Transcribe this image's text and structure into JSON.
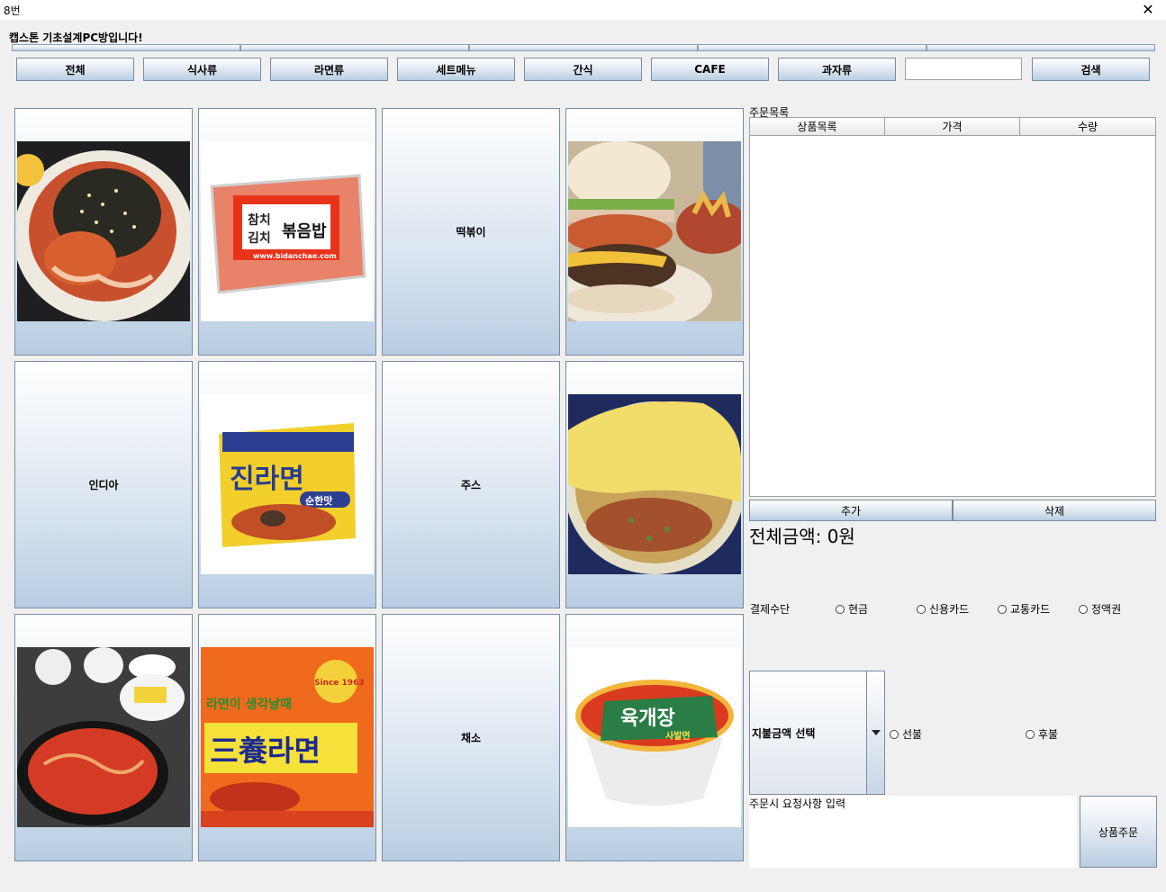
{
  "window": {
    "title": "8번",
    "close_glyph": "✕"
  },
  "header": {
    "text": "캡스톤 기초설계PC방입니다!"
  },
  "categories": [
    "전체",
    "식사류",
    "라면류",
    "세트메뉴",
    "간식",
    "CAFE",
    "과자류"
  ],
  "search": {
    "value": "",
    "button_label": "검색"
  },
  "menu_tiles": [
    {
      "label": "",
      "image": "bibimbap-photo"
    },
    {
      "label": "",
      "image": "fried-rice-package-photo",
      "image_text": [
        "참치",
        "김치",
        "볶음밥",
        "www.bidanchae.com"
      ]
    },
    {
      "label": "떡볶이",
      "image": ""
    },
    {
      "label": "",
      "image": "hamburger-photo"
    },
    {
      "label": "인디아",
      "image": ""
    },
    {
      "label": "",
      "image": "jin-ramen-package-photo",
      "image_text": [
        "진라면",
        "순한맛"
      ]
    },
    {
      "label": "주스",
      "image": ""
    },
    {
      "label": "",
      "image": "omurice-photo"
    },
    {
      "label": "",
      "image": "ramen-bowl-photo"
    },
    {
      "label": "",
      "image": "samyang-ramen-package-photo",
      "image_text": [
        "라면이 생각날때",
        "三養라면",
        "Since 1963"
      ]
    },
    {
      "label": "채소",
      "image": ""
    },
    {
      "label": "",
      "image": "yukgaejang-cup-photo",
      "image_text": [
        "육개장",
        "사발면"
      ]
    }
  ],
  "order": {
    "section_label": "주문목록",
    "columns": [
      "상품목록",
      "가격",
      "수량"
    ],
    "rows": [],
    "add_label": "추가",
    "delete_label": "삭제",
    "total_text": "전체금액: 0원"
  },
  "payment": {
    "label": "결제수단",
    "options": [
      "현금",
      "신용카드",
      "교통카드",
      "정액권"
    ]
  },
  "amount": {
    "combo_text": "지불금액 선택",
    "timing_options": [
      "선불",
      "후불"
    ]
  },
  "request": {
    "placeholder": "주문시 요청사항 입력"
  },
  "submit_label": "상품주문",
  "colors": {
    "button_top": "#ffffff",
    "button_bottom": "#b8cde3",
    "background": "#f0f0f0"
  }
}
